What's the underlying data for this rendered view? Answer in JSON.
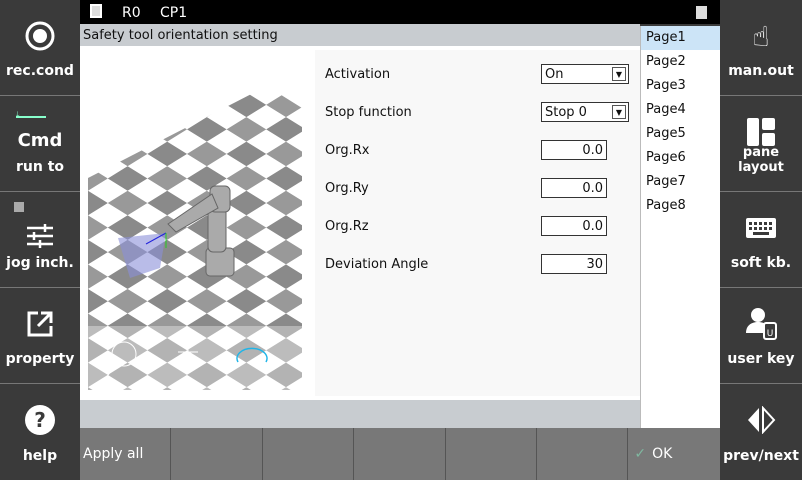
{
  "left_sidebar": [
    {
      "label": "rec.cond",
      "icon": "record-icon"
    },
    {
      "label": "run to",
      "title": "Cmd",
      "icon": "step-icon"
    },
    {
      "label": "jog inch.",
      "icon": "sliders-icon"
    },
    {
      "label": "property",
      "icon": "external-link-icon"
    },
    {
      "label": "help",
      "icon": "help-icon"
    }
  ],
  "right_sidebar": [
    {
      "label": "man.out",
      "icon": "hand-pointer-icon"
    },
    {
      "label": "pane layout",
      "icon": "layout-icon"
    },
    {
      "label": "soft kb.",
      "icon": "keyboard-icon"
    },
    {
      "label": "user key",
      "icon": "user-key-icon"
    },
    {
      "label": "prev/next",
      "icon": "prev-next-icon"
    }
  ],
  "status": {
    "robot": "R0",
    "program": "CP1"
  },
  "title": "Safety tool orientation setting",
  "form": {
    "activation": {
      "label": "Activation",
      "value": "On"
    },
    "stop_function": {
      "label": "Stop function",
      "value": "Stop 0"
    },
    "org_rx": {
      "label": "Org.Rx",
      "value": "0.0"
    },
    "org_ry": {
      "label": "Org.Ry",
      "value": "0.0"
    },
    "org_rz": {
      "label": "Org.Rz",
      "value": "0.0"
    },
    "deviation": {
      "label": "Deviation Angle",
      "value": "30"
    }
  },
  "pages": [
    "Page1",
    "Page2",
    "Page3",
    "Page4",
    "Page5",
    "Page6",
    "Page7",
    "Page8"
  ],
  "active_page": "Page1",
  "bottom": {
    "apply_all": "Apply all",
    "ok": "OK"
  },
  "colors": {
    "accent": "#cce4f7",
    "ok_check": "#7fb8a0",
    "rotate": "#1fb5e8"
  }
}
